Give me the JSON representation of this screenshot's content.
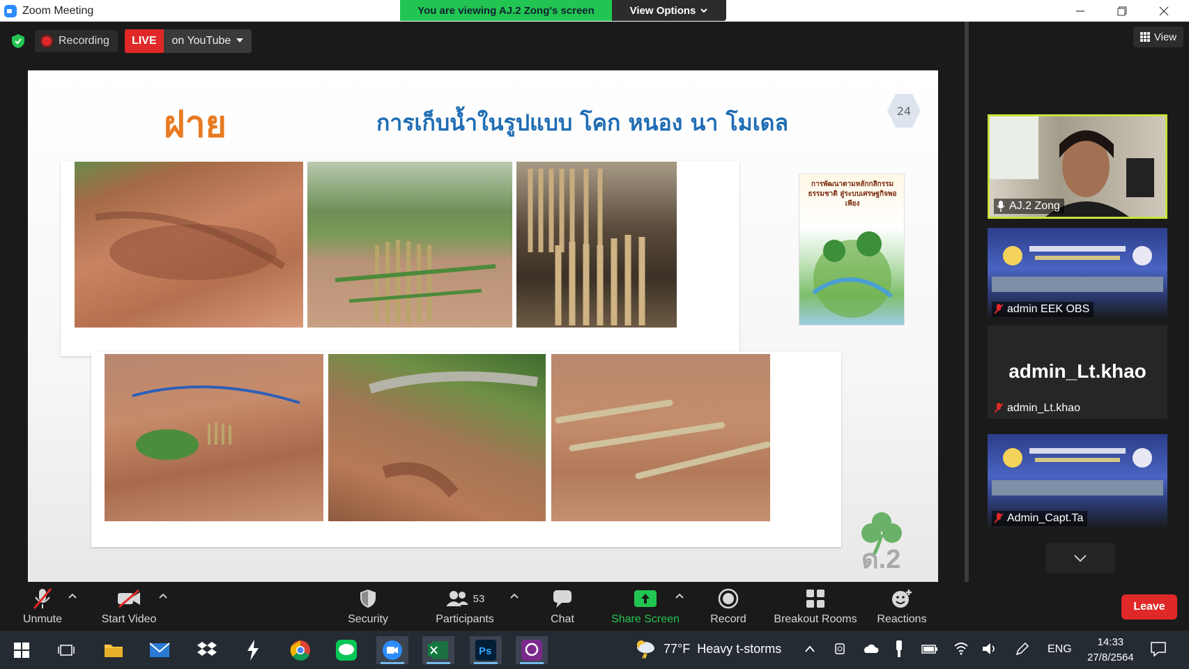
{
  "window": {
    "title": "Zoom Meeting",
    "viewing_banner": "You are viewing AJ.2 Zong's screen",
    "view_options": "View Options"
  },
  "status_bar": {
    "recording_label": "Recording",
    "live_label": "LIVE",
    "live_destination": "on YouTube"
  },
  "slide": {
    "title": "ฝาย",
    "heading": "การเก็บน้ำในรูปแบบ โคก หนอง นา โมเดล",
    "page_number": "24",
    "book_title": "การพัฒนาตามหลักกสิกรรมธรรมชาติ สู่ระบบเศรษฐกิจพอเพียง",
    "watermark": "ด.2"
  },
  "right_panel": {
    "view_label": "View",
    "participants": [
      {
        "name": "AJ.2 Zong",
        "active": true
      },
      {
        "name": "admin EEK OBS"
      },
      {
        "name": "admin_Lt.khao",
        "display": "admin_Lt.khao"
      },
      {
        "name": "Admin_Capt.Ta"
      }
    ]
  },
  "toolbar": {
    "unmute": "Unmute",
    "start_video": "Start Video",
    "security": "Security",
    "participants": "Participants",
    "participants_count": "53",
    "chat": "Chat",
    "share_screen": "Share Screen",
    "record": "Record",
    "breakout_rooms": "Breakout Rooms",
    "reactions": "Reactions",
    "leave": "Leave"
  },
  "taskbar": {
    "weather_temp": "77°F",
    "weather_desc": "Heavy t-storms",
    "language": "ENG",
    "time": "14:33",
    "date": "27/8/2564"
  },
  "colors": {
    "accent_green": "#23c552",
    "live_red": "#e02828",
    "active_border": "#c8e33c",
    "title_orange": "#e87a22",
    "heading_blue": "#1f6db4"
  }
}
